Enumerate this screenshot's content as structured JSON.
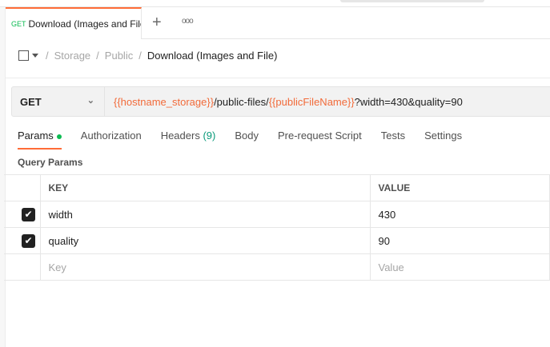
{
  "tab": {
    "method": "GET",
    "title": "Download (Images and File)",
    "new_tab": "+",
    "more": "ooo"
  },
  "breadcrumb": {
    "items": [
      "Storage",
      "Public"
    ],
    "current": "Download (Images and File)",
    "separator": "/"
  },
  "request": {
    "method": "GET",
    "url_parts": {
      "var1": "{{hostname_storage}}",
      "path": "/public-files/",
      "var2": "{{publicFileName}}",
      "query": "?width=430&quality=90"
    }
  },
  "req_tabs": {
    "params": "Params",
    "authorization": "Authorization",
    "headers": "Headers",
    "headers_count": "(9)",
    "body": "Body",
    "prerequest": "Pre-request Script",
    "tests": "Tests",
    "settings": "Settings"
  },
  "query_params": {
    "title": "Query Params",
    "col_key": "KEY",
    "col_value": "VALUE",
    "rows": [
      {
        "key": "width",
        "value": "430",
        "checked": true
      },
      {
        "key": "quality",
        "value": "90",
        "checked": true
      }
    ],
    "key_placeholder": "Key",
    "value_placeholder": "Value"
  },
  "colors": {
    "accent": "#ff6c37",
    "variable": "#f26b3a",
    "get": "#0cbb52"
  }
}
